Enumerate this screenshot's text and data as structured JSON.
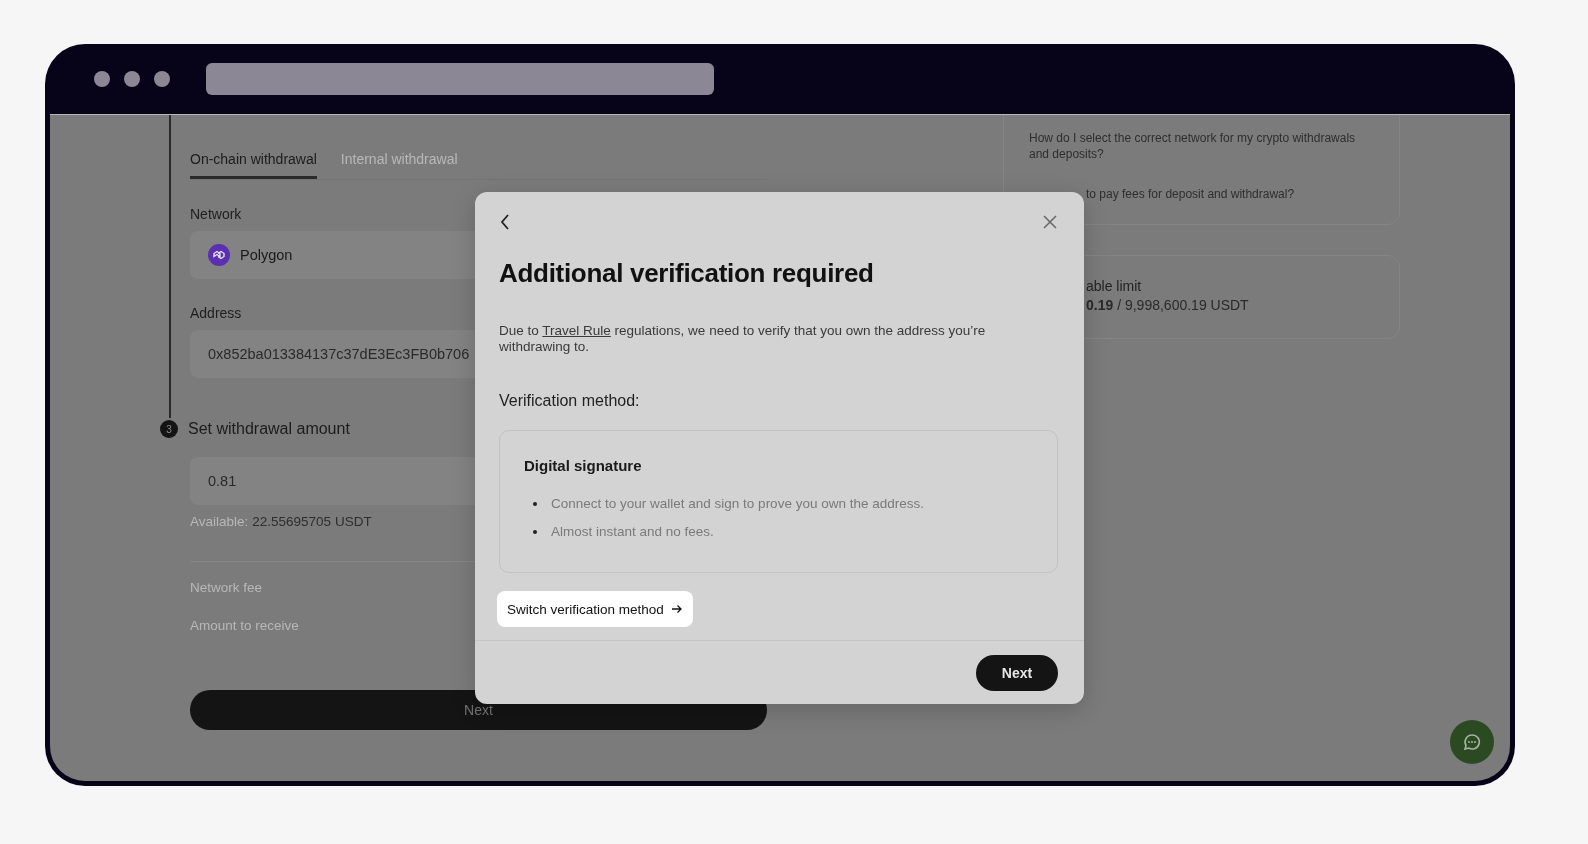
{
  "tabs": [
    {
      "label": "On-chain withdrawal",
      "selected": true
    },
    {
      "label": "Internal withdrawal",
      "selected": false
    }
  ],
  "network": {
    "label": "Network",
    "value": "Polygon"
  },
  "address": {
    "label": "Address",
    "value": "0x852ba013384137c37dE3Ec3FB0b706"
  },
  "amount_step": {
    "number": "3",
    "title": "Set withdrawal amount"
  },
  "amount": {
    "value": "0.81"
  },
  "available": {
    "label": "Available:",
    "value": "22.55695705 USDT"
  },
  "summary": [
    "Network fee",
    "Amount to receive"
  ],
  "next_button": "Next",
  "faq": [
    {
      "kind": "full",
      "text": "How do I select the correct network for my crypto withdrawals and deposits?"
    },
    {
      "kind": "clipped",
      "text": "to pay fees for deposit and withdrawal?"
    }
  ],
  "limit": {
    "label": "able limit",
    "value": "**0.19** / 9,998,600.19 USDT"
  },
  "modal": {
    "title": "Additional verification required",
    "intro_before": "Due to",
    "intro_link": "Travel Rule",
    "intro_after": "regulations, we need to verify that you own the address you’re withdrawing to.",
    "method_label": "Verification method:",
    "method": {
      "title": "Digital signature",
      "points": [
        "Connect to your wallet and sign to prove you own the address.",
        "Almost instant and no fees."
      ]
    },
    "switch_button": "Switch verification method",
    "next_button": "Next"
  }
}
